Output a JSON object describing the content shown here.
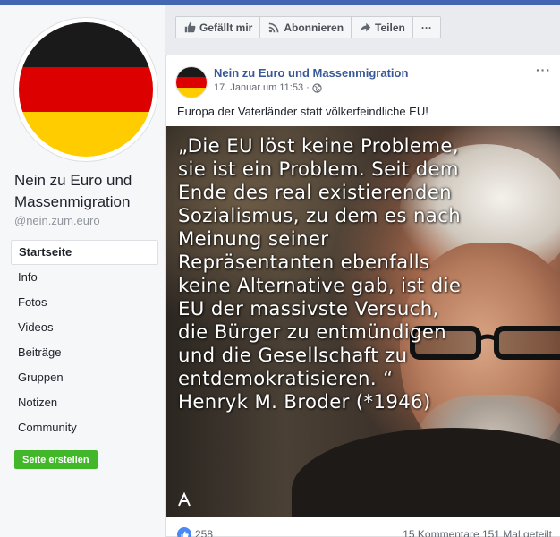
{
  "page": {
    "name": "Nein zu Euro und Massenmigration",
    "handle": "@nein.zum.euro"
  },
  "actions": {
    "like": "Gefällt mir",
    "follow": "Abonnieren",
    "share": "Teilen",
    "more": "···"
  },
  "sidebar": {
    "items": [
      {
        "label": "Startseite",
        "active": true
      },
      {
        "label": "Info"
      },
      {
        "label": "Fotos"
      },
      {
        "label": "Videos"
      },
      {
        "label": "Beiträge"
      },
      {
        "label": "Gruppen"
      },
      {
        "label": "Notizen"
      },
      {
        "label": "Community"
      }
    ],
    "create_button": "Seite erstellen"
  },
  "post": {
    "author": "Nein zu Euro und Massenmigration",
    "date": "17. Januar um 11:53 ·",
    "menu": "···",
    "text": "Europa der Vaterländer statt völkerfeindliche EU!",
    "image_quote": "„Die EU löst keine Probleme, sie ist ein Problem. Seit dem Ende des real existierenden Sozialismus, zu dem es nach Meinung seiner Repräsentanten ebenfalls keine Alternative gab, ist die EU der massivste Versuch, die Bürger zu entmündigen und die Gesellschaft zu entdemokratisieren. “ Henryk M. Broder (*1946)",
    "likes": "258",
    "stats": "15 Kommentare  151 Mal geteilt"
  },
  "colors": {
    "accent": "#4267b2",
    "link": "#385898",
    "create_button": "#42b72a",
    "flag_black": "#1a1a1a",
    "flag_red": "#dd0000",
    "flag_gold": "#ffcc00"
  }
}
